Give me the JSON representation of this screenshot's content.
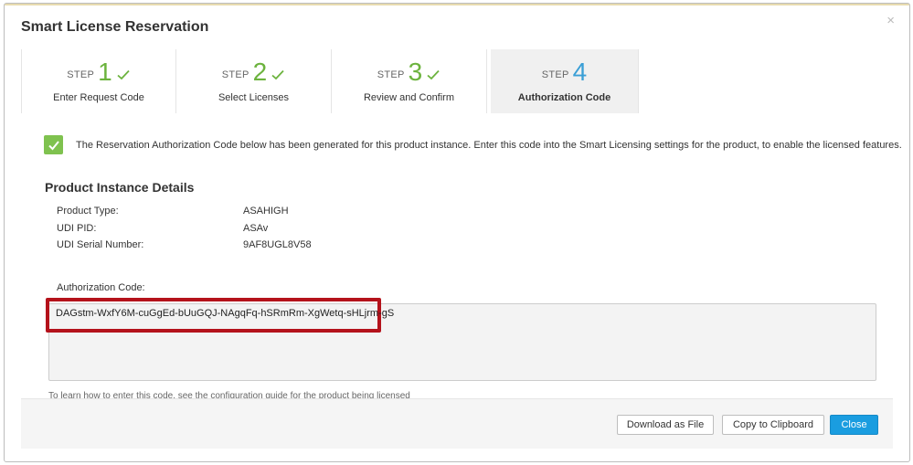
{
  "dialog": {
    "title": "Smart License Reservation",
    "close_glyph": "×"
  },
  "steps": [
    {
      "word": "STEP",
      "number": "1",
      "label": "Enter Request Code",
      "status": "complete",
      "icon": "check-icon"
    },
    {
      "word": "STEP",
      "number": "2",
      "label": "Select Licenses",
      "status": "complete",
      "icon": "check-icon"
    },
    {
      "word": "STEP",
      "number": "3",
      "label": "Review and Confirm",
      "status": "complete",
      "icon": "check-icon"
    },
    {
      "word": "STEP",
      "number": "4",
      "label": "Authorization Code",
      "status": "active"
    }
  ],
  "notice": {
    "text": "The Reservation Authorization Code below has been generated for this product instance. Enter this code into the Smart Licensing settings for the product, to enable the licensed features.",
    "icon": "checkbox-checked-icon"
  },
  "details": {
    "title": "Product Instance Details",
    "rows": [
      {
        "key": "Product Type:",
        "value": "ASAHIGH"
      },
      {
        "key": "UDI PID:",
        "value": "ASAv"
      },
      {
        "key": "UDI Serial Number:",
        "value": "9AF8UGL8V58"
      }
    ]
  },
  "authorization": {
    "label": "Authorization Code:",
    "code": "DAGstm-WxfY6M-cuGgEd-bUuGQJ-NAgqFq-hSRmRm-XgWetq-sHLjrm-gS",
    "help": "To learn how to enter this code, see the configuration guide for the product being licensed"
  },
  "footer": {
    "download_label": "Download as File",
    "copy_label": "Copy to Clipboard",
    "close_label": "Close"
  },
  "colors": {
    "complete_green": "#6cb33e",
    "active_blue": "#3a9fd6",
    "highlight_red": "#b4121b",
    "primary_button": "#1a9de0"
  }
}
